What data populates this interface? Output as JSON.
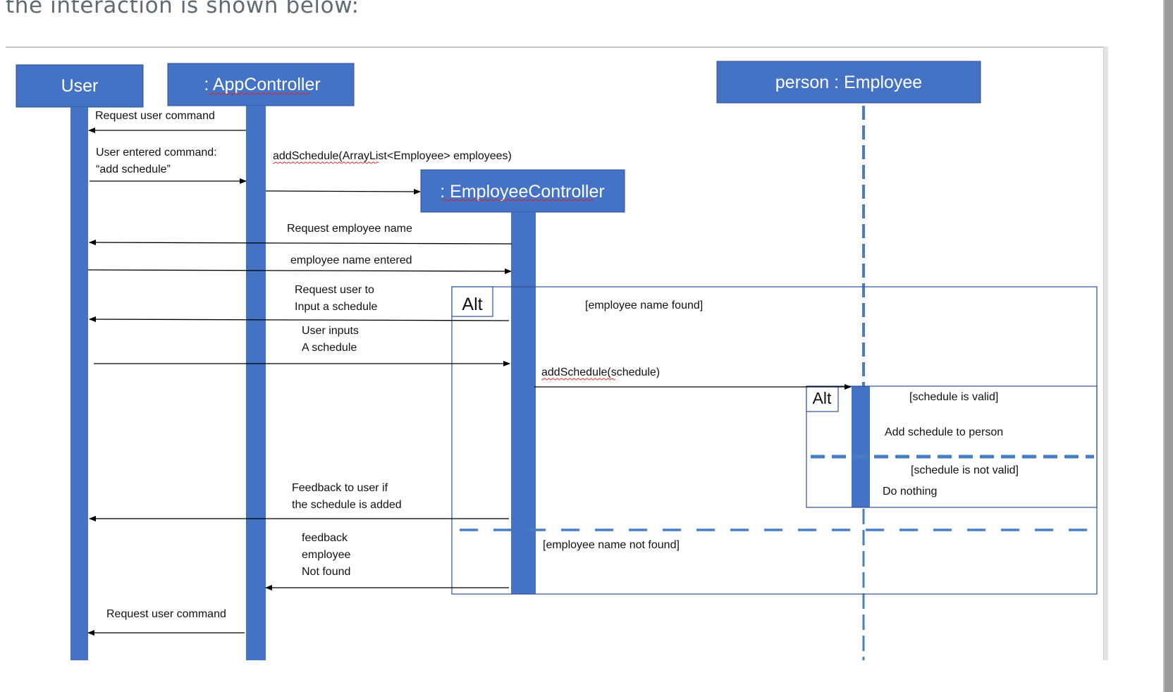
{
  "page": {
    "heading": "the interaction is shown below:"
  },
  "colors": {
    "participant_fill": "#4472c4",
    "participant_border": "#2f528f",
    "dashed_lifeline": "#4a7ec2",
    "fragment_border": "#2f4f9a",
    "arrow": "#000000",
    "heading_text": "#5f6b73",
    "scrollbar": "#9a9a9a"
  },
  "diagram": {
    "type": "sequence",
    "participants": [
      {
        "id": "user",
        "label": "User"
      },
      {
        "id": "app",
        "label": ": AppController"
      },
      {
        "id": "emp_ctrl",
        "label": ": EmployeeController"
      },
      {
        "id": "person",
        "label": "person : Employee"
      }
    ],
    "messages": [
      {
        "from": "app",
        "to": "user",
        "lines": [
          "Request user command"
        ]
      },
      {
        "from": "user",
        "to": "app",
        "lines": [
          "User entered command:",
          "“add schedule”"
        ]
      },
      {
        "from": "app",
        "to": "emp_ctrl",
        "lines": [
          "addSchedule(ArrayList<Employee> employees)"
        ]
      },
      {
        "from": "emp_ctrl",
        "to": "user",
        "lines": [
          "Request employee name"
        ]
      },
      {
        "from": "user",
        "to": "emp_ctrl",
        "lines": [
          "employee name entered"
        ]
      },
      {
        "from": "emp_ctrl",
        "to": "user",
        "lines": [
          "Request user to",
          "Input a schedule"
        ]
      },
      {
        "from": "user",
        "to": "emp_ctrl",
        "lines": [
          "User inputs",
          "A schedule"
        ]
      },
      {
        "from": "emp_ctrl",
        "to": "person",
        "lines": [
          "addSchedule(schedule)"
        ]
      },
      {
        "from": "emp_ctrl",
        "to": "user",
        "lines": [
          "Feedback to user if",
          "the schedule is added"
        ]
      },
      {
        "from": "emp_ctrl",
        "to": "app",
        "lines": [
          "feedback",
          "employee",
          "Not found"
        ]
      },
      {
        "from": "app",
        "to": "user",
        "lines": [
          "Request user command"
        ]
      }
    ],
    "fragments": [
      {
        "kind": "Alt",
        "label": "Alt",
        "guards": [
          "[employee name found]",
          "[employee name not found]"
        ]
      },
      {
        "kind": "Alt",
        "label": "Alt",
        "guards": [
          "[schedule is valid]",
          "[schedule is not valid]"
        ],
        "notes": [
          "Add schedule to person",
          "Do nothing"
        ]
      }
    ]
  }
}
